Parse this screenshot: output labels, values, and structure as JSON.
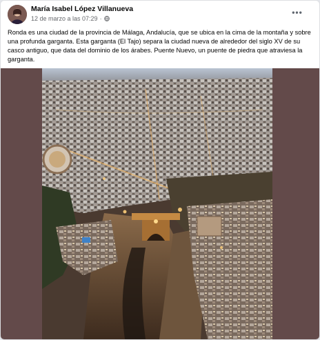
{
  "post": {
    "author": "María Isabel López Villanueva",
    "date": "12 de marzo a las 07:29",
    "separator": "·",
    "text": "Ronda es una ciudad de la provincia de Málaga, Andalucía, que se ubica en la cima de la montaña y sobre una profunda garganta. Esta garganta (El Tajo) separa la ciudad nueva de alrededor del siglo XV de su casco antiguo, que data del dominio de los árabes. Puente Nuevo, un puente de piedra que atraviesa la garganta.",
    "more_label": "•••"
  },
  "icons": {
    "privacy": "globe-icon",
    "options": "more-options-icon",
    "avatar": "profile-avatar"
  },
  "colors": {
    "photo_background": "#634a4a",
    "author_text": "#050505",
    "meta_text": "#65676b"
  }
}
